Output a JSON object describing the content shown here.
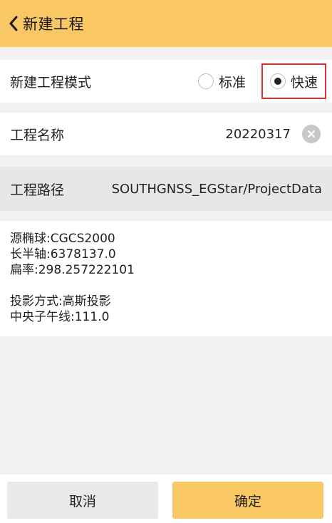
{
  "header": {
    "title": "新建工程",
    "back_icon": "chevron-left-icon"
  },
  "mode": {
    "label": "新建工程模式",
    "options": [
      {
        "label": "标准",
        "selected": false
      },
      {
        "label": "快速",
        "selected": true
      }
    ]
  },
  "project_name": {
    "label": "工程名称",
    "value": "20220317",
    "clear_icon": "clear-icon"
  },
  "project_path": {
    "label": "工程路径",
    "value": "SOUTHGNSS_EGStar/ProjectData"
  },
  "info": {
    "ellipsoid": "源椭球:CGCS2000",
    "semi_major_axis": "长半轴:6378137.0",
    "flattening": "扁率:298.257222101",
    "projection": "投影方式:高斯投影",
    "central_meridian": "中央子午线:111.0"
  },
  "footer": {
    "cancel_label": "取消",
    "ok_label": "确定"
  },
  "colors": {
    "accent": "#f9c865",
    "highlight_border": "#e03030"
  }
}
